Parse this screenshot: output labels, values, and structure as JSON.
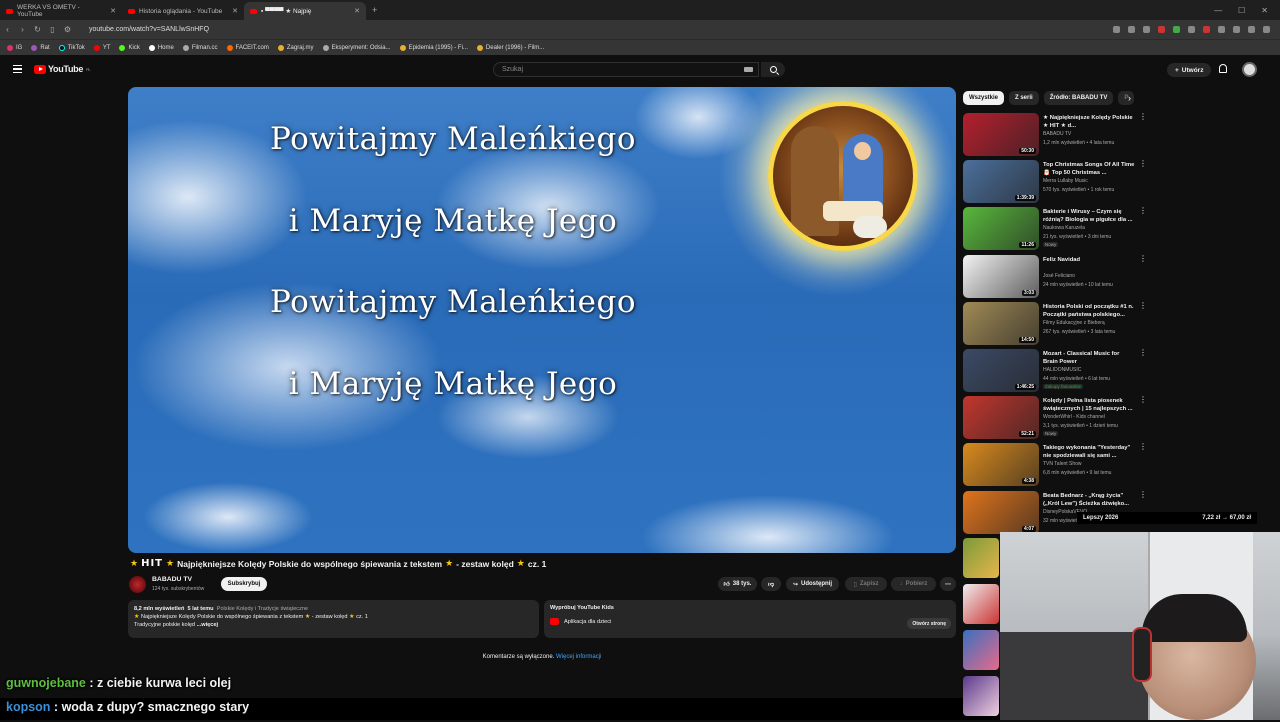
{
  "browser": {
    "tabs": [
      {
        "title": "WERKA VS OMETV - YouTube"
      },
      {
        "title": "Historia oglądania - YouTube"
      },
      {
        "title": "▪ ▀▀▀▀ ★ Najpię"
      }
    ],
    "new_tab": "+",
    "url": "youtube.com/watch?v=SANLlwSnHFQ",
    "bookmarks": [
      "IG",
      "Rat",
      "TikTok",
      "YT",
      "Kick",
      "Home",
      "Filman.cc",
      "FACEIT.com",
      "Zagraj.my",
      "Eksperyment: Odsia...",
      "Epidemia (1995) - Fi...",
      "Dealer (1996) - Film..."
    ]
  },
  "header": {
    "logo_text": "YouTube",
    "logo_region": "PL",
    "search_placeholder": "Szukaj",
    "create_label": "Utwórz"
  },
  "video": {
    "lyrics": [
      "Powitajmy Maleńkiego",
      "i Maryję Matkę Jego",
      "Powitajmy Maleńkiego",
      "i Maryję Matkę Jego"
    ],
    "title_logo": "HIT",
    "title_text": "Najpiękniejsze Kolędy Polskie do wspólnego śpiewania z tekstem",
    "title_suffix": "- zestaw kolęd",
    "title_part": "cz. 1",
    "channel_name": "BABADU TV",
    "channel_subs": "124 tys. subskrybentów",
    "subscribe_label": "Subskrybuj",
    "likes_label": "38 tys.",
    "share_label": "Udostępnij",
    "save_label": "Zapisz",
    "download_label": "Pobierz",
    "more_label": "⋯"
  },
  "description": {
    "views": "8,2 mln wyświetleń",
    "age": "5 lat temu",
    "tags": "Polskie Kolędy i Tradycje świąteczne",
    "line1": "Najpiękniejsze Kolędy Polskie do wspólnego śpiewania z tekstem",
    "line1_suffix": "- zestaw kolęd",
    "line1_part": "cz. 1",
    "line2": "Tradycyjne polskie kolęd",
    "more": "...więcej"
  },
  "kids_promo": {
    "title": "Wypróbuj YouTube Kids",
    "app_label": "Aplikacja dla dzieci",
    "open_label": "Otwórz stronę"
  },
  "comments": {
    "disabled_text": "Komentarze są wyłączone.",
    "more_info": "Więcej informacji"
  },
  "chat": [
    {
      "user": "guwnojebane",
      "message": "z ciebie kurwa leci olej"
    },
    {
      "user": "kopson",
      "message": "woda z dupy? smacznego stary"
    }
  ],
  "sidebar": {
    "chips": [
      "Wszystkie",
      "Z serii",
      "Źródło: BABADU TV",
      "P"
    ],
    "recommendations": [
      {
        "title": "★ Najpiękniejsze Kolędy Polskie ★ HIT ★ d...",
        "channel": "BABADU TV",
        "meta": "1,2 mln wyświetleń • 4 lata temu",
        "duration": "50:30",
        "thumb_color": "#b51f2e",
        "badge": ""
      },
      {
        "title": "Top Christmas Songs Of All Time 🎅 Top 50 Christmas ...",
        "channel": "Merra Lullaby Music",
        "meta": "570 tys. wyświetleń • 1 rok temu",
        "duration": "1:39:39",
        "thumb_color": "#4b6f9c",
        "badge": ""
      },
      {
        "title": "Bakterie i Wirusy – Czym się różnią? Biologia w pigułce dla ...",
        "channel": "Naukowa Karuzela",
        "meta": "21 tys. wyświetleń • 3 dni temu",
        "duration": "11:26",
        "thumb_color": "#58b83c",
        "badge": "Nowy"
      },
      {
        "title": "Feliz Navidad",
        "channel": "José Feliciano",
        "meta": "24 mln wyświetleń • 10 lat temu",
        "duration": "3:03",
        "thumb_color": "#f3f3f3",
        "badge": ""
      },
      {
        "title": "Historia Polski od początku #1 n. Początki państwa polskiego...",
        "channel": "Filmy Edukacyjne z Bieberą",
        "meta": "267 tys. wyświetleń • 3 lata temu",
        "duration": "14:50",
        "thumb_color": "#a08a55",
        "badge": ""
      },
      {
        "title": "Mozart - Classical Music for Brain Power",
        "channel": "HALIDONMUSIC",
        "meta": "44 mln wyświetleń • 6 lat temu",
        "duration": "1:46:25",
        "thumb_color": "#3b4a66",
        "badge": "Zakupy fanowskie"
      },
      {
        "title": "Kolędy | Pełna lista piosenek świątecznych | 15 najlepszych ...",
        "channel": "WonderWhirl - Kids channel",
        "meta": "3,1 tys. wyświetleń • 1 dzień temu",
        "duration": "52:21",
        "thumb_color": "#c2362e",
        "badge": "Nowy"
      },
      {
        "title": "Takiego wykonania \"Yesterday\" nie spodziewali się sami ...",
        "channel": "TVN Talent Show",
        "meta": "6,8 mln wyświetleń • 9 lat temu",
        "duration": "4:38",
        "thumb_color": "#d98a1e",
        "badge": ""
      },
      {
        "title": "Beata Bednarz - „Krąg życia” („Król Lew”) Ścieżka dźwięko...",
        "channel": "DisneyPolskaVEVO",
        "meta": "32 mln wyświetleń • 1",
        "duration": "4:07",
        "thumb_color": "#e0741c",
        "badge": ""
      }
    ]
  },
  "overlay": {
    "strip_left": "Lepszy 2026",
    "strip_right": "7,22 zł → 67,00 zł"
  }
}
